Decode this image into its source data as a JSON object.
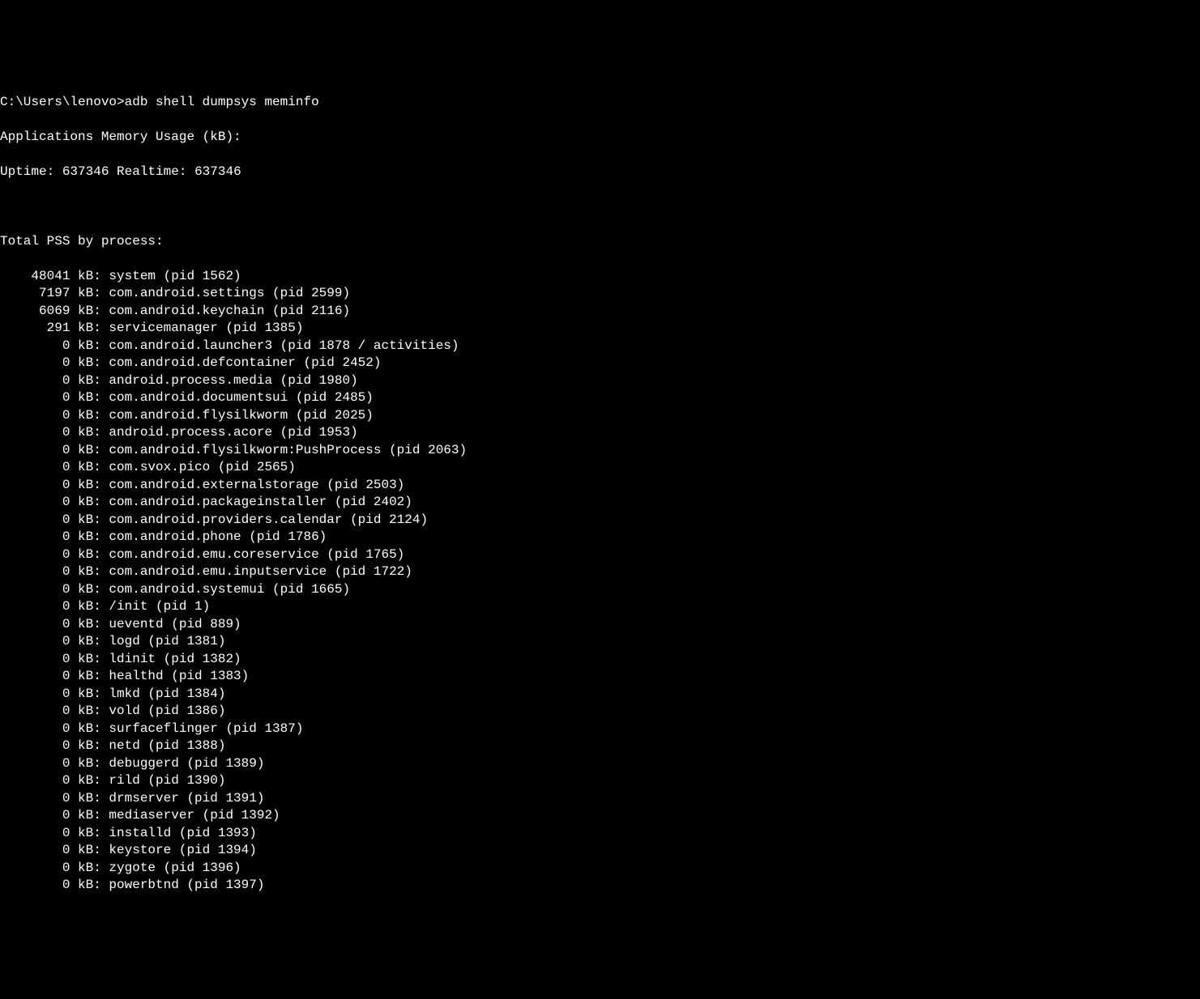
{
  "prompt": "C:\\Users\\lenovo>",
  "command": "adb shell dumpsys meminfo",
  "header1": "Applications Memory Usage (kB):",
  "uptime_label": "Uptime:",
  "uptime_value": "637346",
  "realtime_label": "Realtime:",
  "realtime_value": "637346",
  "section_header": "Total PSS by process:",
  "processes": [
    {
      "kb": "48041",
      "name": "system",
      "pid": "1562",
      "extra": ""
    },
    {
      "kb": "7197",
      "name": "com.android.settings",
      "pid": "2599",
      "extra": ""
    },
    {
      "kb": "6069",
      "name": "com.android.keychain",
      "pid": "2116",
      "extra": ""
    },
    {
      "kb": "291",
      "name": "servicemanager",
      "pid": "1385",
      "extra": ""
    },
    {
      "kb": "0",
      "name": "com.android.launcher3",
      "pid": "1878",
      "extra": " / activities"
    },
    {
      "kb": "0",
      "name": "com.android.defcontainer",
      "pid": "2452",
      "extra": ""
    },
    {
      "kb": "0",
      "name": "android.process.media",
      "pid": "1980",
      "extra": ""
    },
    {
      "kb": "0",
      "name": "com.android.documentsui",
      "pid": "2485",
      "extra": ""
    },
    {
      "kb": "0",
      "name": "com.android.flysilkworm",
      "pid": "2025",
      "extra": ""
    },
    {
      "kb": "0",
      "name": "android.process.acore",
      "pid": "1953",
      "extra": ""
    },
    {
      "kb": "0",
      "name": "com.android.flysilkworm:PushProcess",
      "pid": "2063",
      "extra": ""
    },
    {
      "kb": "0",
      "name": "com.svox.pico",
      "pid": "2565",
      "extra": ""
    },
    {
      "kb": "0",
      "name": "com.android.externalstorage",
      "pid": "2503",
      "extra": ""
    },
    {
      "kb": "0",
      "name": "com.android.packageinstaller",
      "pid": "2402",
      "extra": ""
    },
    {
      "kb": "0",
      "name": "com.android.providers.calendar",
      "pid": "2124",
      "extra": ""
    },
    {
      "kb": "0",
      "name": "com.android.phone",
      "pid": "1786",
      "extra": ""
    },
    {
      "kb": "0",
      "name": "com.android.emu.coreservice",
      "pid": "1765",
      "extra": ""
    },
    {
      "kb": "0",
      "name": "com.android.emu.inputservice",
      "pid": "1722",
      "extra": ""
    },
    {
      "kb": "0",
      "name": "com.android.systemui",
      "pid": "1665",
      "extra": ""
    },
    {
      "kb": "0",
      "name": "/init",
      "pid": "1",
      "extra": ""
    },
    {
      "kb": "0",
      "name": "ueventd",
      "pid": "889",
      "extra": ""
    },
    {
      "kb": "0",
      "name": "logd",
      "pid": "1381",
      "extra": ""
    },
    {
      "kb": "0",
      "name": "ldinit",
      "pid": "1382",
      "extra": ""
    },
    {
      "kb": "0",
      "name": "healthd",
      "pid": "1383",
      "extra": ""
    },
    {
      "kb": "0",
      "name": "lmkd",
      "pid": "1384",
      "extra": ""
    },
    {
      "kb": "0",
      "name": "vold",
      "pid": "1386",
      "extra": ""
    },
    {
      "kb": "0",
      "name": "surfaceflinger",
      "pid": "1387",
      "extra": ""
    },
    {
      "kb": "0",
      "name": "netd",
      "pid": "1388",
      "extra": ""
    },
    {
      "kb": "0",
      "name": "debuggerd",
      "pid": "1389",
      "extra": ""
    },
    {
      "kb": "0",
      "name": "rild",
      "pid": "1390",
      "extra": ""
    },
    {
      "kb": "0",
      "name": "drmserver",
      "pid": "1391",
      "extra": ""
    },
    {
      "kb": "0",
      "name": "mediaserver",
      "pid": "1392",
      "extra": ""
    },
    {
      "kb": "0",
      "name": "installd",
      "pid": "1393",
      "extra": ""
    },
    {
      "kb": "0",
      "name": "keystore",
      "pid": "1394",
      "extra": ""
    },
    {
      "kb": "0",
      "name": "zygote",
      "pid": "1396",
      "extra": ""
    },
    {
      "kb": "0",
      "name": "powerbtnd",
      "pid": "1397",
      "extra": ""
    }
  ]
}
